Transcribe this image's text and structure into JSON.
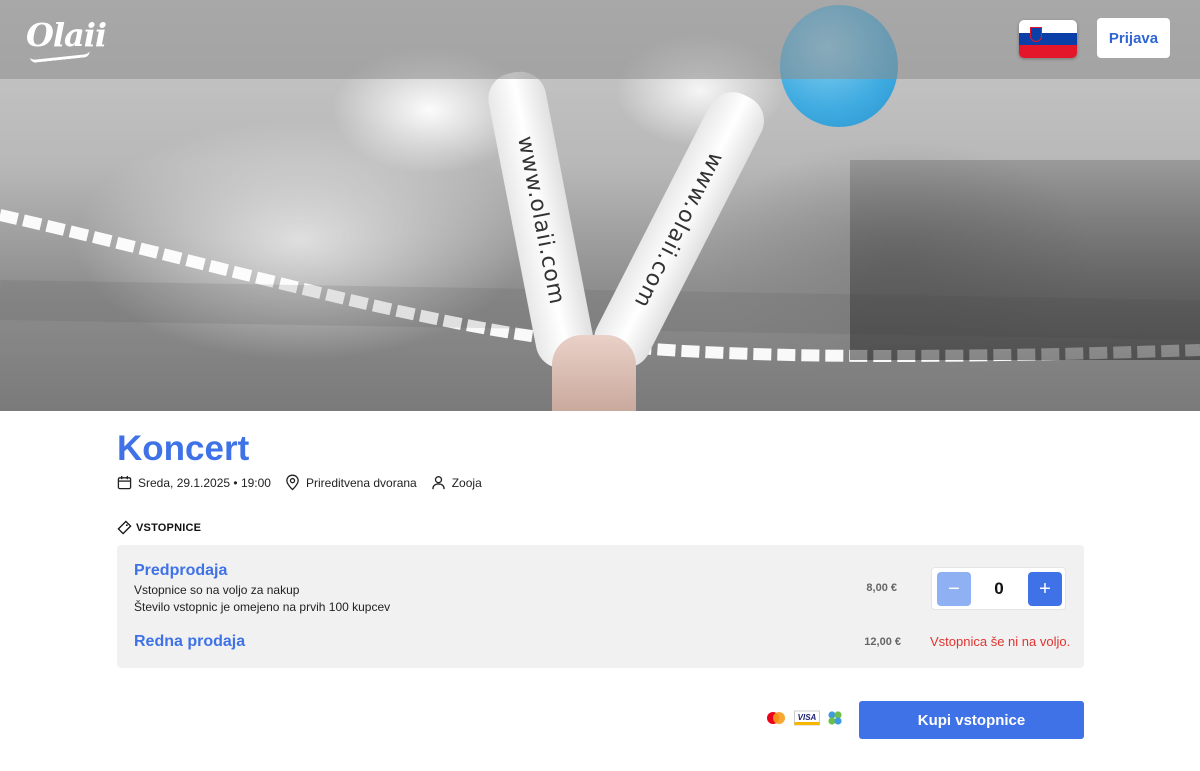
{
  "header": {
    "logo_text": "Olaii",
    "language_flag": "slovenia-flag",
    "login_label": "Prijava"
  },
  "hero": {
    "stick_text_1": "www.olaii.com",
    "stick_text_2": "www.olaii.com"
  },
  "event": {
    "title": "Koncert",
    "date": "Sreda, 29.1.2025 • 19:00",
    "venue": "Prireditvena dvorana",
    "organizer": "Zooja"
  },
  "tickets_section": {
    "label": "VSTOPNICE",
    "items": [
      {
        "name": "Predprodaja",
        "description_1": "Vstopnice so na voljo za nakup",
        "description_2": "Število vstopnic je omejeno na prvih 100 kupcev",
        "price": "8,00 €",
        "quantity": "0",
        "minus_label": "−",
        "plus_label": "+"
      },
      {
        "name": "Redna prodaja",
        "price": "12,00 €",
        "status": "Vstopnica še ni na voljo."
      }
    ]
  },
  "checkout": {
    "payment_icons": [
      "mastercard-icon",
      "visa-icon",
      "clover-icon"
    ],
    "visa_text": "VISA",
    "buy_label": "Kupi vstopnice"
  },
  "colors": {
    "accent": "#3f72e6",
    "accent_light": "#8fb0f3",
    "error": "#e0332f",
    "panel": "#f1f1f1"
  }
}
